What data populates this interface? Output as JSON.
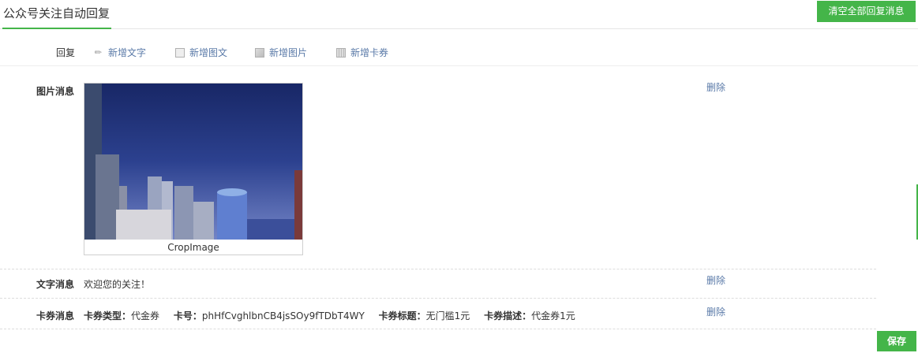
{
  "header": {
    "tab_title": "公众号关注自动回复",
    "clear_all_button": "清空全部回复消息"
  },
  "reply_bar": {
    "label": "回复",
    "actions": [
      {
        "label": "新增文字",
        "icon": "pencil-icon"
      },
      {
        "label": "新增图文",
        "icon": "article-icon"
      },
      {
        "label": "新增图片",
        "icon": "image-icon"
      },
      {
        "label": "新增卡券",
        "icon": "card-icon"
      }
    ]
  },
  "messages": {
    "image": {
      "label": "图片消息",
      "caption": "CropImage",
      "delete": "删除"
    },
    "text": {
      "label": "文字消息",
      "content": "欢迎您的关注！",
      "delete": "删除"
    },
    "card": {
      "label": "卡券消息",
      "type_label": "卡券类型：",
      "type_value": "代金券",
      "number_label": "卡号：",
      "number_value": "phHfCvghlbnCB4jsSOy9fTDbT4WY",
      "title_label": "卡券标题：",
      "title_value": "无门槛1元",
      "desc_label": "卡券描述：",
      "desc_value": "代金券1元",
      "delete": "删除"
    }
  },
  "footer": {
    "save_button": "保存"
  },
  "colors": {
    "accent_green": "#44b549",
    "link_blue": "#5a7aa8"
  }
}
